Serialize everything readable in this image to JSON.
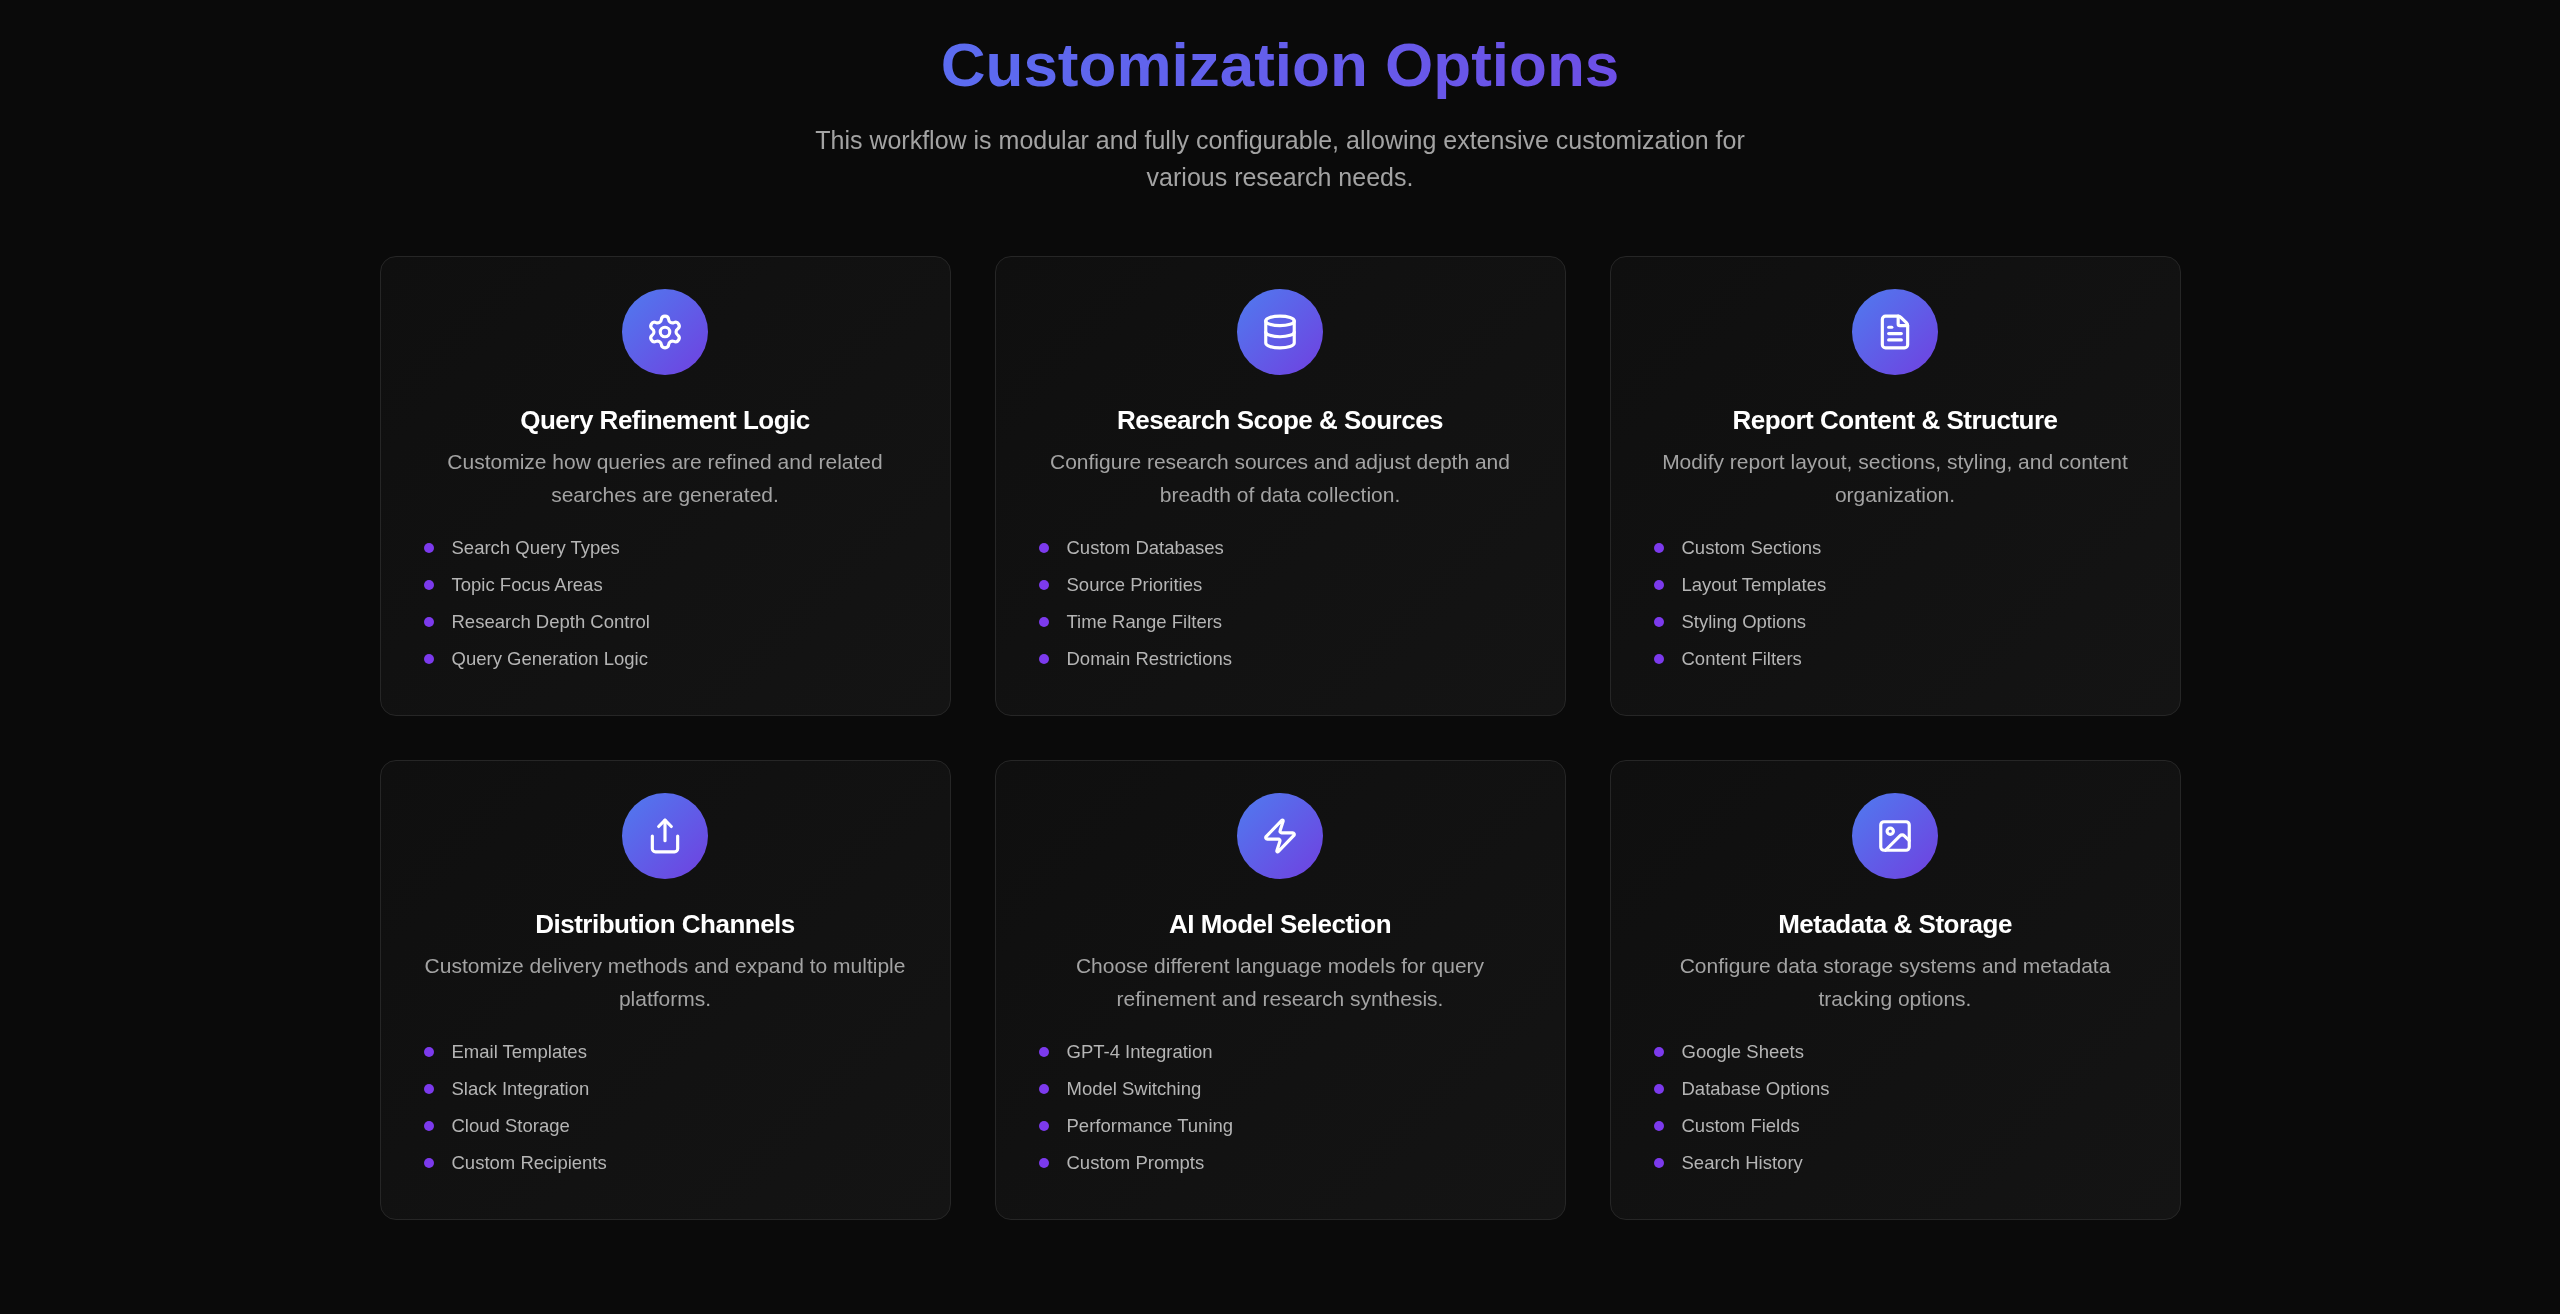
{
  "header": {
    "title": "Customization Options",
    "subtitle": "This workflow is modular and fully configurable, allowing extensive customization for various research needs."
  },
  "cards": [
    {
      "title": "Query Refinement Logic",
      "description": "Customize how queries are refined and related searches are generated.",
      "items": [
        "Search Query Types",
        "Topic Focus Areas",
        "Research Depth Control",
        "Query Generation Logic"
      ]
    },
    {
      "title": "Research Scope & Sources",
      "description": "Configure research sources and adjust depth and breadth of data collection.",
      "items": [
        "Custom Databases",
        "Source Priorities",
        "Time Range Filters",
        "Domain Restrictions"
      ]
    },
    {
      "title": "Report Content & Structure",
      "description": "Modify report layout, sections, styling, and content organization.",
      "items": [
        "Custom Sections",
        "Layout Templates",
        "Styling Options",
        "Content Filters"
      ]
    },
    {
      "title": "Distribution Channels",
      "description": "Customize delivery methods and expand to multiple platforms.",
      "items": [
        "Email Templates",
        "Slack Integration",
        "Cloud Storage",
        "Custom Recipients"
      ]
    },
    {
      "title": "AI Model Selection",
      "description": "Choose different language models for query refinement and research synthesis.",
      "items": [
        "GPT-4 Integration",
        "Model Switching",
        "Performance Tuning",
        "Custom Prompts"
      ]
    },
    {
      "title": "Metadata & Storage",
      "description": "Configure data storage systems and metadata tracking options.",
      "items": [
        "Google Sheets",
        "Database Options",
        "Custom Fields",
        "Search History"
      ]
    }
  ]
}
